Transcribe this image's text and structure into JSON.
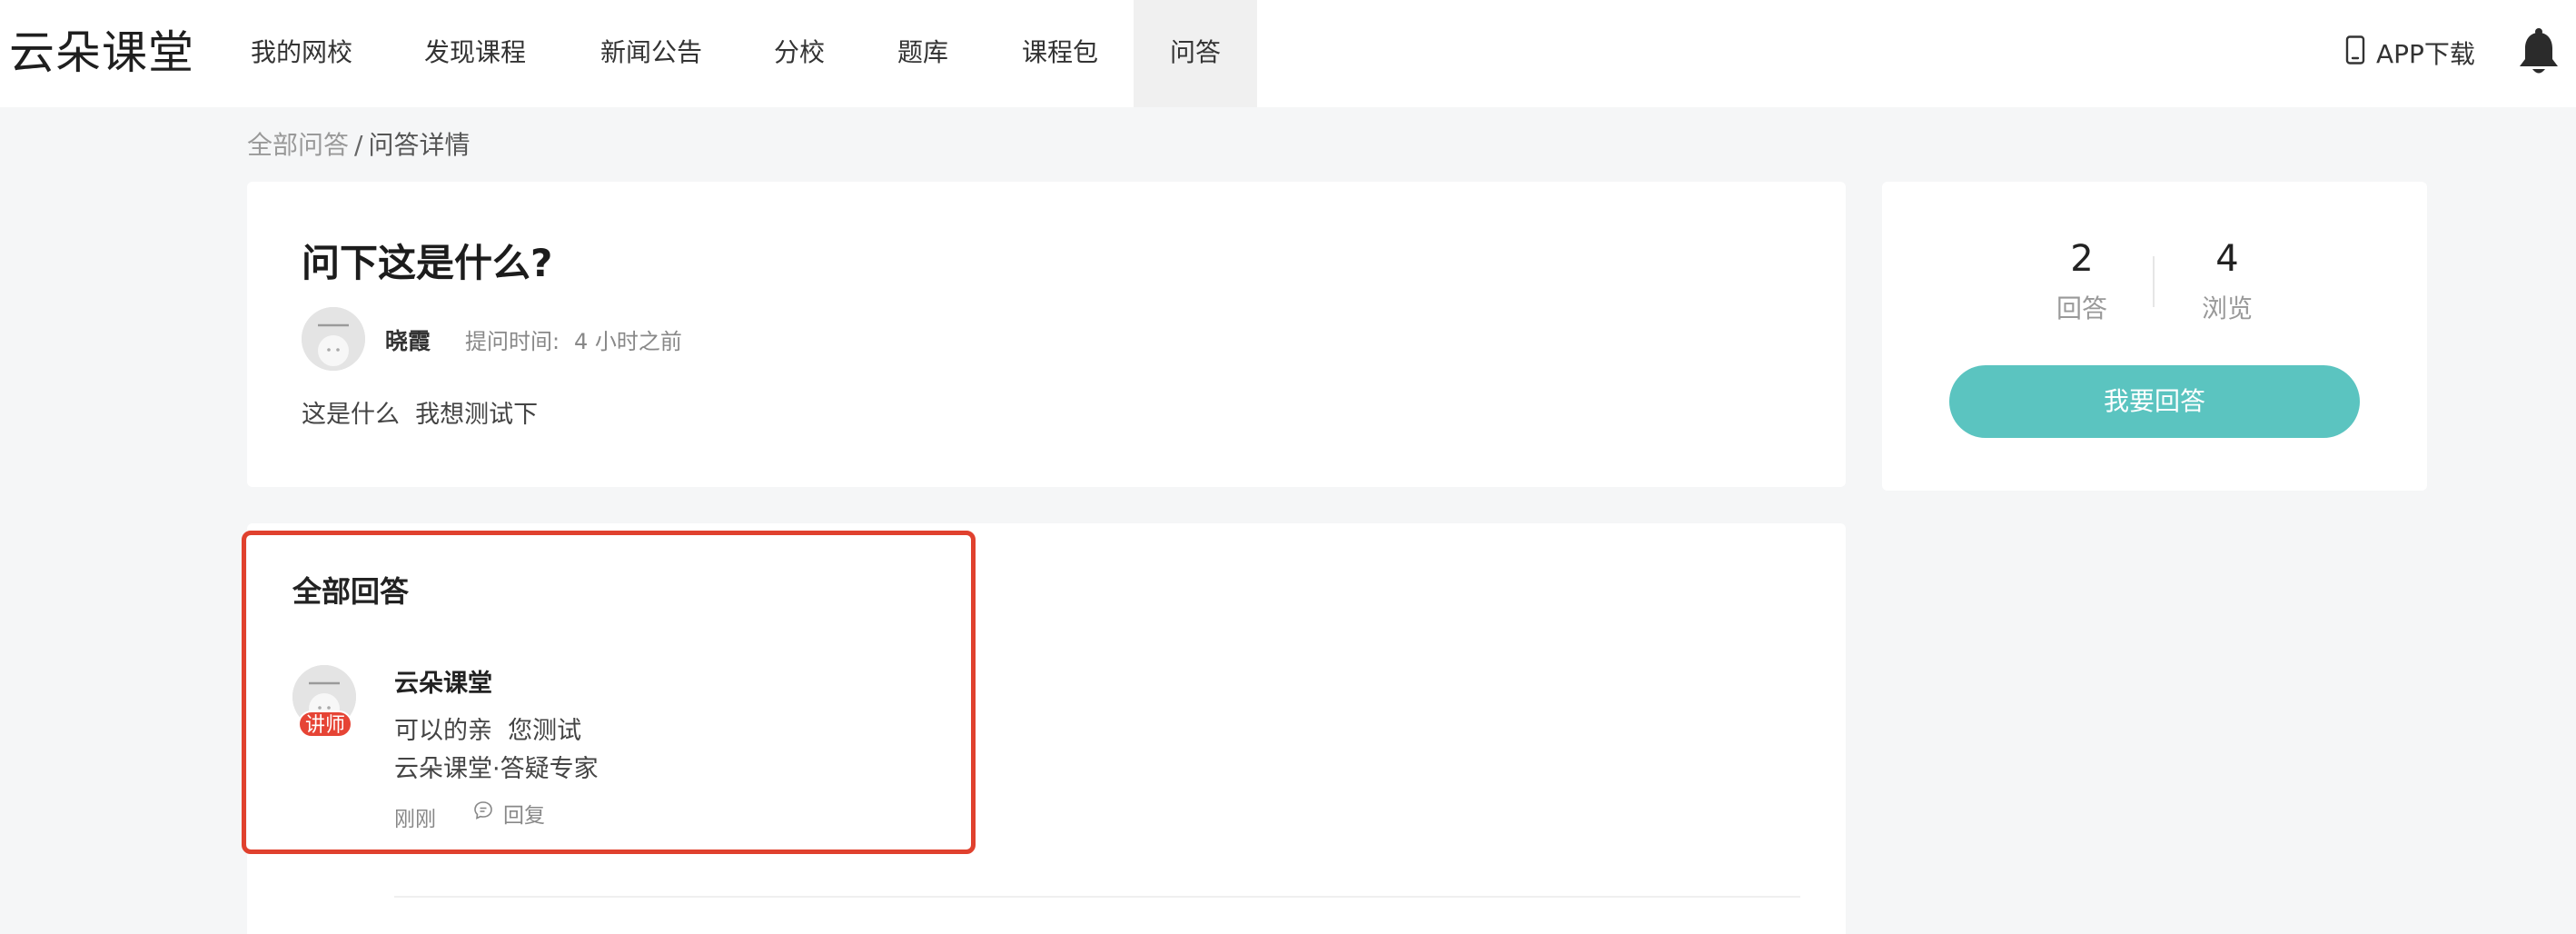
{
  "header": {
    "logo": "云朵课堂",
    "nav": [
      "我的网校",
      "发现课程",
      "新闻公告",
      "分校",
      "题库",
      "课程包",
      "问答"
    ],
    "active_nav": "问答",
    "app_download": "APP下载"
  },
  "breadcrumb": {
    "root": "全部问答",
    "separator": "/",
    "current": "问答详情"
  },
  "question": {
    "title": "问下这是什么?",
    "author": "晓霞",
    "time_label": "提问时间:",
    "time_value": "4 小时之前",
    "body": "这是什么  我想测试下"
  },
  "stats": {
    "answers_count": "2",
    "answers_label": "回答",
    "views_count": "4",
    "views_label": "浏览",
    "answer_button": "我要回答"
  },
  "answers": {
    "title": "全部回答",
    "items": [
      {
        "badge": "讲师",
        "name": "云朵课堂",
        "text": "可以的亲  您测试",
        "signature": "云朵课堂·答疑专家",
        "time": "刚刚",
        "reply_label": "回复"
      }
    ]
  },
  "colors": {
    "accent": "#5bc4c0",
    "highlight_border": "#e0412e",
    "teacher_badge": "#e64435",
    "page_bg": "#f5f6f7"
  },
  "icons": [
    "phone-icon",
    "bell-icon",
    "avatar-placeholder-icon",
    "comment-icon"
  ]
}
